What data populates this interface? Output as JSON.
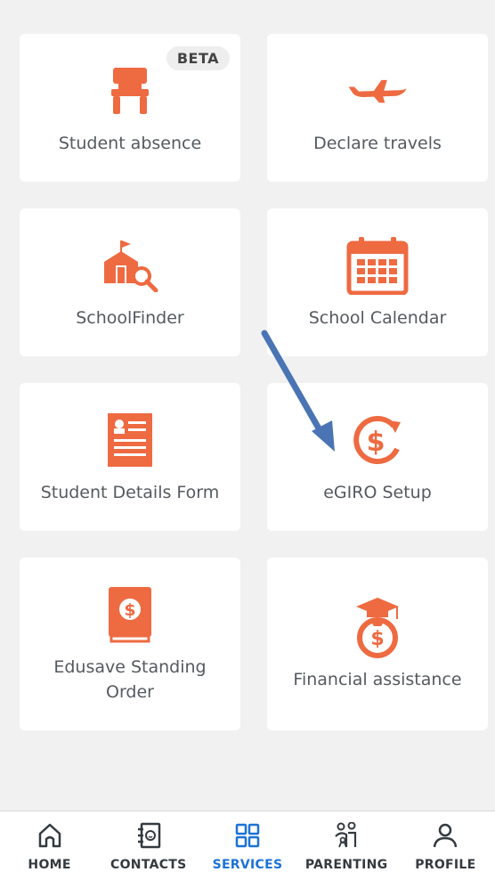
{
  "tiles": [
    {
      "label": "Student absence",
      "icon": "chair-icon",
      "badge": "BETA"
    },
    {
      "label": "Declare travels",
      "icon": "airplane-icon"
    },
    {
      "label": "SchoolFinder",
      "icon": "school-search-icon"
    },
    {
      "label": "School Calendar",
      "icon": "calendar-icon"
    },
    {
      "label": "Student Details Form",
      "icon": "id-form-icon"
    },
    {
      "label": "eGIRO Setup",
      "icon": "dollar-cycle-icon"
    },
    {
      "label": "Edusave Standing Order",
      "icon": "dollar-book-icon"
    },
    {
      "label": "Financial assistance",
      "icon": "graduation-money-bag-icon"
    }
  ],
  "nav": {
    "items": [
      {
        "label": "HOME",
        "icon": "home-icon"
      },
      {
        "label": "CONTACTS",
        "icon": "contacts-icon"
      },
      {
        "label": "SERVICES",
        "icon": "grid-icon",
        "active": true
      },
      {
        "label": "PARENTING",
        "icon": "parenting-icon"
      },
      {
        "label": "PROFILE",
        "icon": "person-icon"
      }
    ]
  },
  "colors": {
    "accent": "#ee6a41",
    "active_nav": "#1c72d6",
    "annotation_arrow": "#4a74b4",
    "background": "#f1f1f2"
  }
}
